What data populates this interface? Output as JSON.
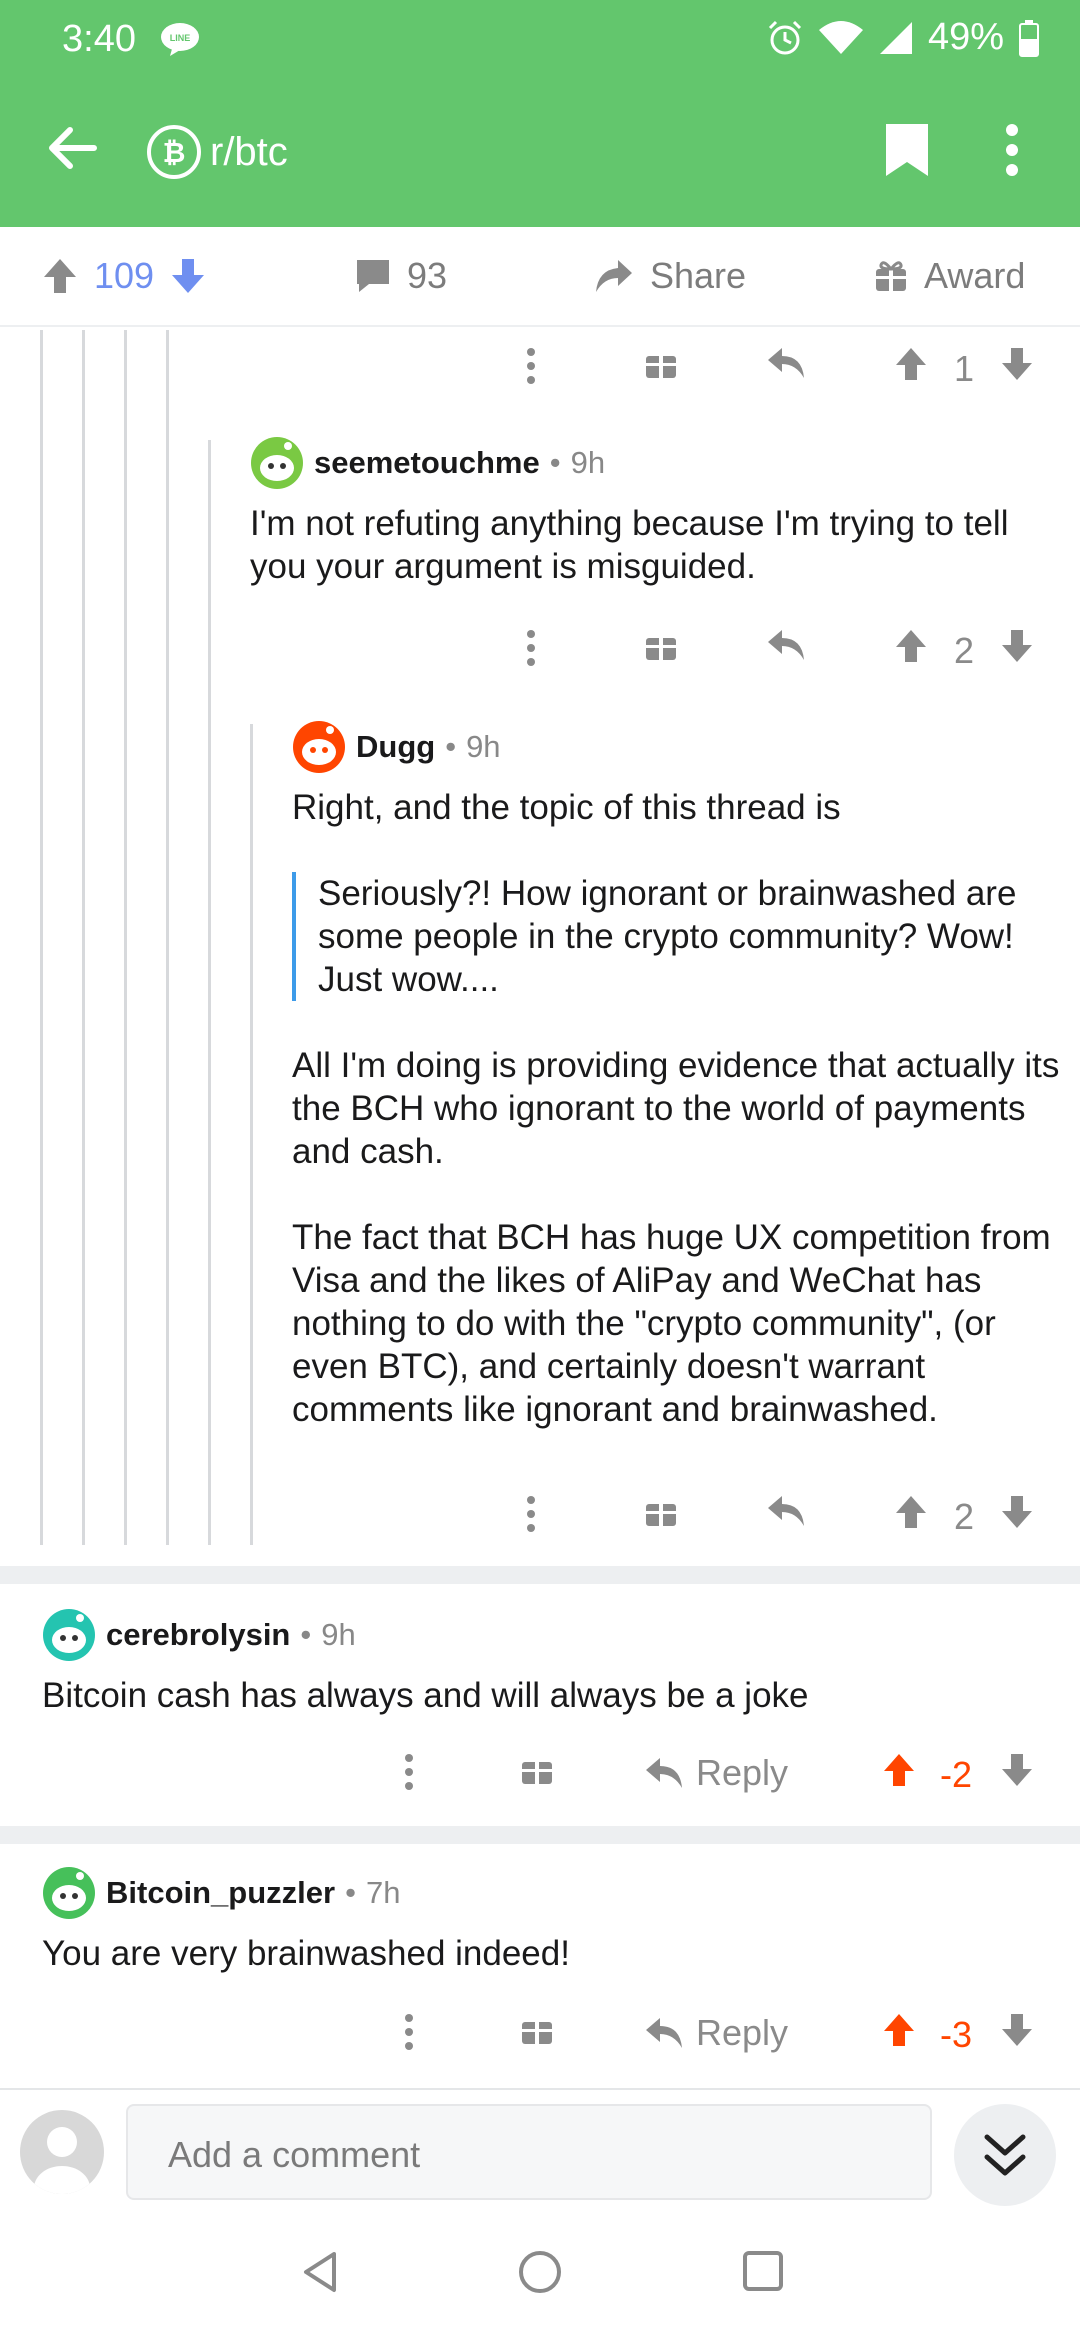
{
  "status": {
    "time": "3:40",
    "battery": "49%"
  },
  "header": {
    "subreddit": "r/btc"
  },
  "post_actions": {
    "score": "109",
    "comments": "93",
    "share": "Share",
    "award": "Award"
  },
  "colors": {
    "brand": "#63c66d",
    "upvoted": "#ff4500",
    "vote_blue": "#6f8ff0",
    "quote_bar": "#3d9be9"
  },
  "top_action_row": {
    "score": "1"
  },
  "comments": [
    {
      "user": "seemetouchme",
      "age": "9h",
      "body": "I'm not refuting anything because I'm trying to tell you your argument is misguided.",
      "score": "2"
    },
    {
      "user": "Dugg",
      "age": "9h",
      "intro": "Right, and the topic of this thread is",
      "quote": "Seriously?! How ignorant or brainwashed are some people in the crypto community? Wow! Just wow....",
      "para1": "All I'm doing is providing evidence that actually its the BCH who ignorant to the world of payments and cash.",
      "para2": "The fact that BCH has huge UX competition from Visa and the likes of AliPay and WeChat has nothing to do with the \"crypto community\", (or even BTC), and certainly doesn't warrant comments like ignorant and brainwashed.",
      "score": "2"
    },
    {
      "user": "cerebrolysin",
      "age": "9h",
      "body": "Bitcoin cash has always and will always be a joke",
      "reply": "Reply",
      "score": "-2"
    },
    {
      "user": "Bitcoin_puzzler",
      "age": "7h",
      "body": "You are very brainwashed indeed!",
      "reply": "Reply",
      "score": "-3"
    }
  ],
  "composer": {
    "placeholder": "Add a comment"
  },
  "icons": {
    "back": "arrow-left-icon",
    "subreddit": "bitcoin-icon",
    "bookmark": "bookmark-icon",
    "more": "more-vertical-icon",
    "upvote": "arrow-up-icon",
    "downvote": "arrow-down-icon",
    "comment": "comment-icon",
    "share": "share-icon",
    "award": "gift-icon",
    "reply": "reply-icon",
    "jump": "double-chevron-down-icon"
  }
}
